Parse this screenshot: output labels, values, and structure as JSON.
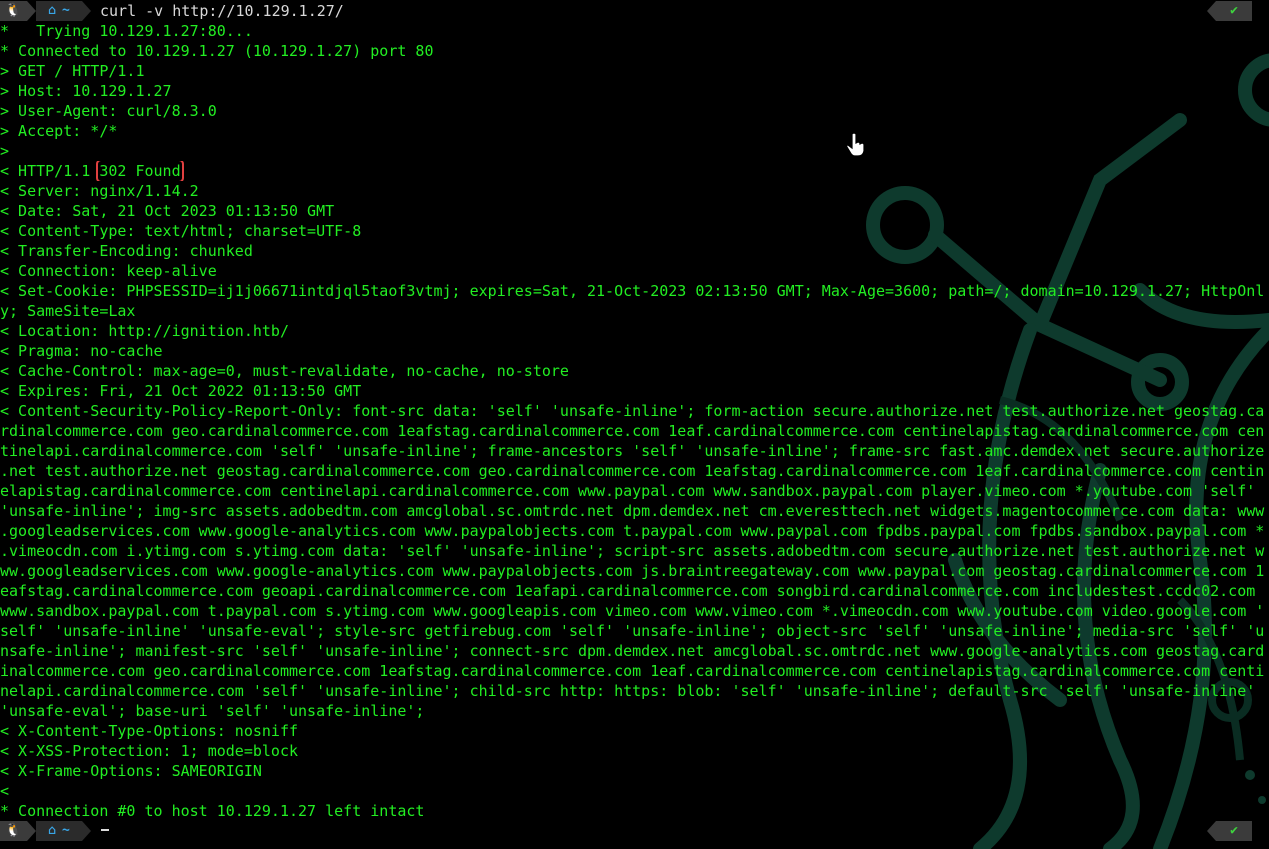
{
  "prompt": {
    "os_icon": "🐧",
    "home_icon": "⌂",
    "dir": "~",
    "status_icon": "✔"
  },
  "command": "curl -v http://10.129.1.27/",
  "highlight_text": "302 Found",
  "output_lines": [
    "*   Trying 10.129.1.27:80...",
    "* Connected to 10.129.1.27 (10.129.1.27) port 80",
    "> GET / HTTP/1.1",
    "> Host: 10.129.1.27",
    "> User-Agent: curl/8.3.0",
    "> Accept: */*",
    ">",
    "< HTTP/1.1 302 Found",
    "< Server: nginx/1.14.2",
    "< Date: Sat, 21 Oct 2023 01:13:50 GMT",
    "< Content-Type: text/html; charset=UTF-8",
    "< Transfer-Encoding: chunked",
    "< Connection: keep-alive",
    "< Set-Cookie: PHPSESSID=ij1j06671intdjql5taof3vtmj; expires=Sat, 21-Oct-2023 02:13:50 GMT; Max-Age=3600; path=/; domain=10.129.1.27; HttpOnl",
    "y; SameSite=Lax",
    "< Location: http://ignition.htb/",
    "< Pragma: no-cache",
    "< Cache-Control: max-age=0, must-revalidate, no-cache, no-store",
    "< Expires: Fri, 21 Oct 2022 01:13:50 GMT",
    "< Content-Security-Policy-Report-Only: font-src data: 'self' 'unsafe-inline'; form-action secure.authorize.net test.authorize.net geostag.ca",
    "rdinalcommerce.com geo.cardinalcommerce.com 1eafstag.cardinalcommerce.com 1eaf.cardinalcommerce.com centinelapistag.cardinalcommerce.com cen",
    "tinelapi.cardinalcommerce.com 'self' 'unsafe-inline'; frame-ancestors 'self' 'unsafe-inline'; frame-src fast.amc.demdex.net secure.authorize",
    ".net test.authorize.net geostag.cardinalcommerce.com geo.cardinalcommerce.com 1eafstag.cardinalcommerce.com 1eaf.cardinalcommerce.com centin",
    "elapistag.cardinalcommerce.com centinelapi.cardinalcommerce.com www.paypal.com www.sandbox.paypal.com player.vimeo.com *.youtube.com 'self'",
    "'unsafe-inline'; img-src assets.adobedtm.com amcglobal.sc.omtrdc.net dpm.demdex.net cm.everesttech.net widgets.magentocommerce.com data: www",
    ".googleadservices.com www.google-analytics.com www.paypalobjects.com t.paypal.com www.paypal.com fpdbs.paypal.com fpdbs.sandbox.paypal.com *",
    ".vimeocdn.com i.ytimg.com s.ytimg.com data: 'self' 'unsafe-inline'; script-src assets.adobedtm.com secure.authorize.net test.authorize.net w",
    "ww.googleadservices.com www.google-analytics.com www.paypalobjects.com js.braintreegateway.com www.paypal.com geostag.cardinalcommerce.com 1",
    "eafstag.cardinalcommerce.com geoapi.cardinalcommerce.com 1eafapi.cardinalcommerce.com songbird.cardinalcommerce.com includestest.ccdc02.com",
    "www.sandbox.paypal.com t.paypal.com s.ytimg.com www.googleapis.com vimeo.com www.vimeo.com *.vimeocdn.com www.youtube.com video.google.com '",
    "self' 'unsafe-inline' 'unsafe-eval'; style-src getfirebug.com 'self' 'unsafe-inline'; object-src 'self' 'unsafe-inline'; media-src 'self' 'u",
    "nsafe-inline'; manifest-src 'self' 'unsafe-inline'; connect-src dpm.demdex.net amcglobal.sc.omtrdc.net www.google-analytics.com geostag.card",
    "inalcommerce.com geo.cardinalcommerce.com 1eafstag.cardinalcommerce.com 1eaf.cardinalcommerce.com centinelapistag.cardinalcommerce.com centi",
    "nelapi.cardinalcommerce.com 'self' 'unsafe-inline'; child-src http: https: blob: 'self' 'unsafe-inline'; default-src 'self' 'unsafe-inline'",
    "'unsafe-eval'; base-uri 'self' 'unsafe-inline';",
    "< X-Content-Type-Options: nosniff",
    "< X-XSS-Protection: 1; mode=block",
    "< X-Frame-Options: SAMEORIGIN",
    "<",
    "* Connection #0 to host 10.129.1.27 left intact"
  ],
  "colors": {
    "output_text": "#22ee22",
    "command_text": "#d8d8d8",
    "highlight_border": "#e14040",
    "dir_text": "#39a5e6",
    "status_ok": "#3ed13e",
    "background": "#000000",
    "wallpaper_stroke": "#0d3a2c"
  }
}
